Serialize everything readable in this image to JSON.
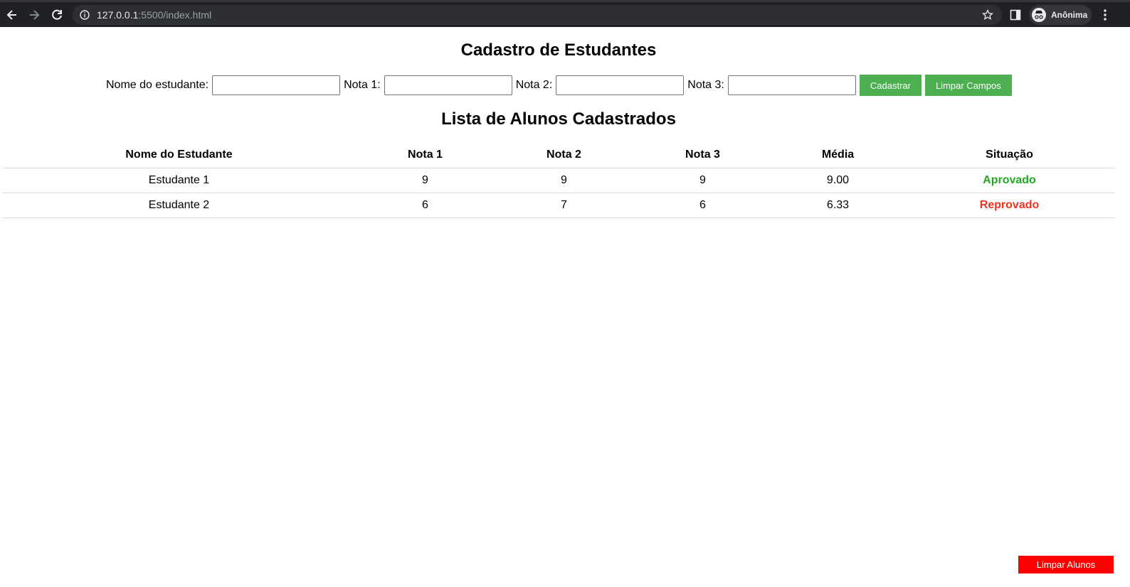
{
  "browser": {
    "url_host": "127.0.0.1",
    "url_rest": ":5500/index.html",
    "profile_label": "Anônima",
    "icons": [
      "back-arrow-icon",
      "forward-arrow-icon",
      "reload-icon",
      "info-icon",
      "star-icon",
      "side-panel-icon",
      "incognito-icon",
      "more-menu-icon"
    ]
  },
  "page": {
    "title": "Cadastro de Estudantes",
    "form": {
      "name_label": "Nome do estudante:",
      "name_value": "",
      "nota1_label": "Nota 1:",
      "nota1_value": "",
      "nota2_label": "Nota 2:",
      "nota2_value": "",
      "nota3_label": "Nota 3:",
      "nota3_value": "",
      "submit_label": "Cadastrar",
      "clear_label": "Limpar Campos"
    },
    "list_title": "Lista de Alunos Cadastrados",
    "table": {
      "headers": [
        "Nome do Estudante",
        "Nota 1",
        "Nota 2",
        "Nota 3",
        "Média",
        "Situação"
      ],
      "rows": [
        {
          "name": "Estudante 1",
          "n1": "9",
          "n2": "9",
          "n3": "9",
          "media": "9.00",
          "status": "Aprovado"
        },
        {
          "name": "Estudante 2",
          "n1": "6",
          "n2": "7",
          "n3": "6",
          "media": "6.33",
          "status": "Reprovado"
        }
      ]
    },
    "clear_students_label": "Limpar Alunos"
  },
  "colors": {
    "green_button": "#4caf50",
    "red_button": "#ff0000",
    "approved": "#22a822",
    "failed": "#f0321e"
  }
}
